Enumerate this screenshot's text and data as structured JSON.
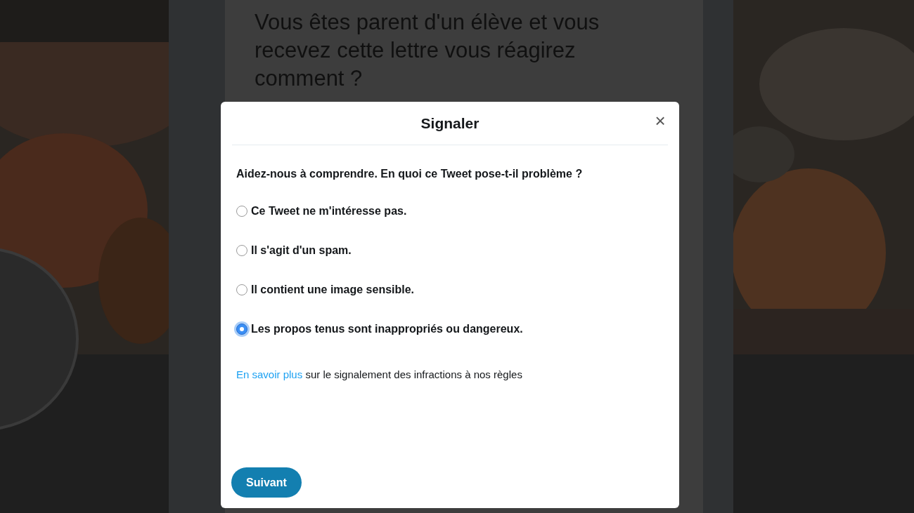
{
  "background": {
    "tweet_text": "Vous êtes parent d'un élève et vous recevez cette lettre vous réagirez comment ?"
  },
  "dialog": {
    "title": "Signaler",
    "close": "×",
    "question": "Aidez-nous à comprendre. En quoi ce Tweet pose-t-il problème ?",
    "options": [
      {
        "label": "Ce Tweet ne m'intéresse pas.",
        "selected": false
      },
      {
        "label": "Il s'agit d'un spam.",
        "selected": false
      },
      {
        "label": "Il contient une image sensible.",
        "selected": false
      },
      {
        "label": "Les propos tenus sont inappropriés ou dangereux.",
        "selected": true
      }
    ],
    "help": {
      "link": "En savoir plus",
      "text": "sur le signalement des infractions à nos règles"
    },
    "button": "Suivant"
  }
}
